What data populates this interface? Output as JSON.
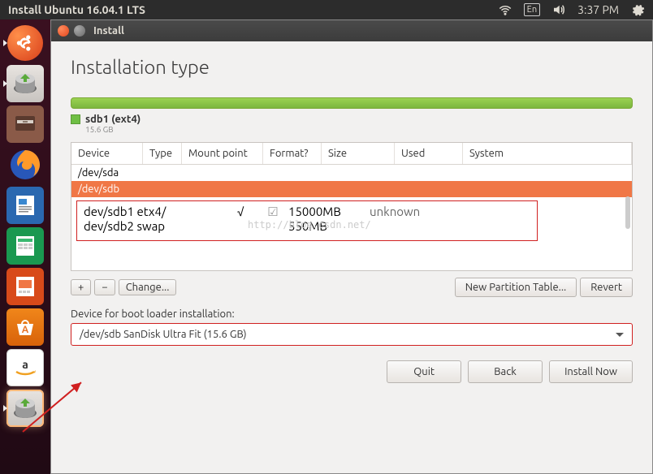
{
  "top_bar": {
    "title": "Install Ubuntu 16.04.1 LTS",
    "lang": "En",
    "time": "3:37 PM"
  },
  "launcher": {
    "items": [
      {
        "name": "ubuntu"
      },
      {
        "name": "installer"
      },
      {
        "name": "files"
      },
      {
        "name": "firefox"
      },
      {
        "name": "writer"
      },
      {
        "name": "calc"
      },
      {
        "name": "impress"
      },
      {
        "name": "software"
      },
      {
        "name": "amazon"
      },
      {
        "name": "installer-active"
      }
    ]
  },
  "window": {
    "title": "Install",
    "heading": "Installation type",
    "partition_label": "sdb1 (ext4)",
    "partition_size": "15.6 GB",
    "table": {
      "headers": {
        "device": "Device",
        "type": "Type",
        "mount": "Mount point",
        "format": "Format?",
        "size": "Size",
        "used": "Used",
        "system": "System"
      },
      "rows": [
        {
          "device": "/dev/sda"
        },
        {
          "device": "/dev/sdb",
          "selected": true
        }
      ],
      "row_under": {
        "device": "/dev/sdb1",
        "type": "ext4",
        "mount": "/",
        "format_checked": true,
        "size": "15000 MB",
        "used": "unknown"
      }
    },
    "overlay": {
      "line1": {
        "device": "dev/sdb1",
        "type": "etx4",
        "mount": "/",
        "format": "√",
        "check": "☑",
        "size": "15000MB",
        "used": "unknown"
      },
      "line2": {
        "device": "dev/sdb2",
        "type": "swap",
        "size": "550MB"
      }
    },
    "watermark": "http://blog.csdn.net/",
    "buttons": {
      "plus": "+",
      "minus": "−",
      "change": "Change...",
      "new_table": "New Partition Table...",
      "revert": "Revert"
    },
    "boot_label": "Device for boot loader installation:",
    "boot_select": "/dev/sdb   SanDisk Ultra Fit (15.6 GB)",
    "footer": {
      "quit": "Quit",
      "back": "Back",
      "install": "Install Now"
    }
  }
}
